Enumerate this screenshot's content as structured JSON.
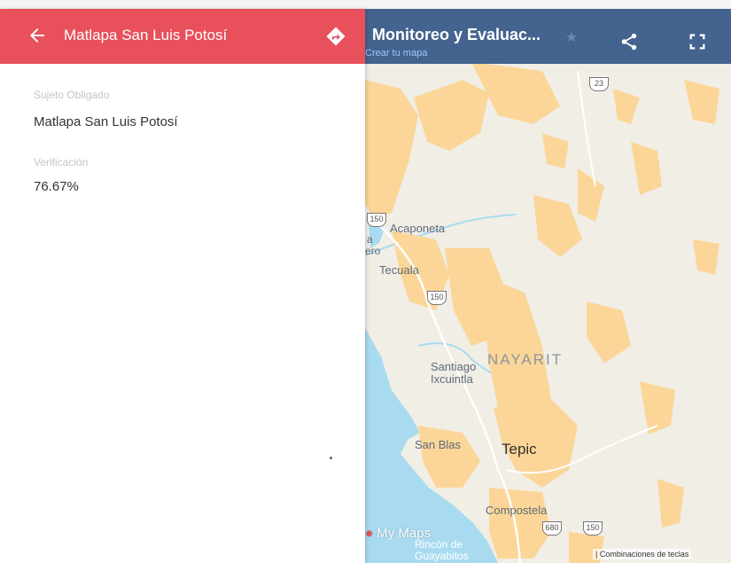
{
  "left_panel": {
    "title": "Matlapa San Luis Potosí",
    "header_color": "#e8505b",
    "fields": [
      {
        "label": "Sujeto Obligado",
        "value": "Matlapa San Luis Potosí"
      },
      {
        "label": "Verificación",
        "value": "76.67%"
      }
    ],
    "icons": {
      "back": "back-arrow-icon",
      "directions": "directions-icon"
    }
  },
  "map_header": {
    "title": "Monitoreo y Evaluac...",
    "link": "Crear tu mapa",
    "header_color": "#44638f",
    "icons": {
      "star": "star-icon",
      "share": "share-icon",
      "fullscreen": "fullscreen-icon"
    }
  },
  "map": {
    "state": "NAYARIT",
    "cities": {
      "acaponeta": "Acaponeta",
      "tecuala": "Tecuala",
      "santiago_1": "Santiago",
      "santiago_2": "Ixcuintla",
      "san_blas": "San Blas",
      "tepic": "Tepic",
      "compostela": "Compostela",
      "rincon_1": "Rincón de",
      "rincon_2": "Guayabitos",
      "partial_a": "a",
      "partial_ero": "ero"
    },
    "routes": {
      "r23": "23",
      "r150a": "150",
      "r150b": "150",
      "r680": "680",
      "r150c": "150"
    },
    "branding": "My Maps",
    "footer_link": "| Combinaciones de teclas",
    "colors": {
      "land": "#f1eee6",
      "urban": "#fbd698",
      "water": "#a9dbf0"
    }
  }
}
